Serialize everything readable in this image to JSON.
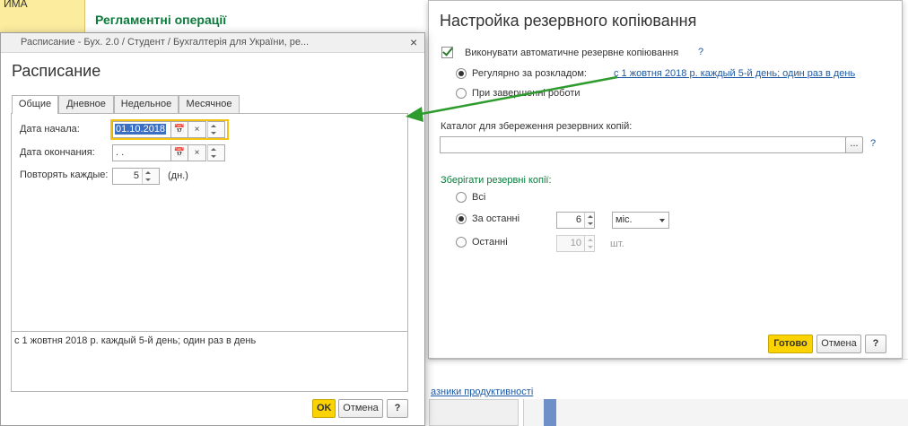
{
  "background": {
    "yellow_label": "ИМА",
    "heading": "Регламентні операції",
    "bottom_link": "азники продуктивності"
  },
  "backup_dialog": {
    "title": "Настройка резервного копіювання",
    "auto_backup_label": "Виконувати автоматичне резервне копіювання",
    "auto_backup_checked": true,
    "help": "?",
    "schedule_option_label": "Регулярно за розкладом:",
    "schedule_link": "с 1 жовтня 2018 р. каждый 5-й день; один раз в день",
    "on_exit_label": "При завершенні роботи",
    "catalog_label": "Каталог для збереження резервних копій:",
    "catalog_value": "",
    "browse_button": "...",
    "keep_label": "Зберігати резервні копії:",
    "all_label": "Всі",
    "last_period_label": "За останні",
    "last_period_value": "6",
    "period_unit": "міс.",
    "last_count_label": "Останні",
    "last_count_value": "10",
    "count_unit": "шт.",
    "done_button": "Готово",
    "cancel_button": "Отмена",
    "help_button": "?"
  },
  "schedule_dialog": {
    "window_title": "Расписание - Бух. 2.0 / Студент / Бухгалтерія для України, ре...",
    "close": "×",
    "title": "Расписание",
    "tabs": [
      "Общие",
      "Дневное",
      "Недельное",
      "Месячное"
    ],
    "start_label": "Дата начала:",
    "start_value": "01.10.2018",
    "end_label": "Дата окончания:",
    "end_value": " .  .",
    "repeat_label": "Повторять каждые:",
    "repeat_value": "5",
    "repeat_unit": "(дн.)",
    "clear": "×",
    "summary": "с 1 жовтня 2018 р. каждый 5-й день; один раз в день",
    "ok_button": "OK",
    "cancel_button": "Отмена",
    "help_button": "?"
  },
  "colors": {
    "accent_green": "#0b7a3b",
    "primary_button": "#fbd300",
    "link": "#1d59a4",
    "focus_border": "#f5c211",
    "arrow": "#2e9b2e"
  }
}
